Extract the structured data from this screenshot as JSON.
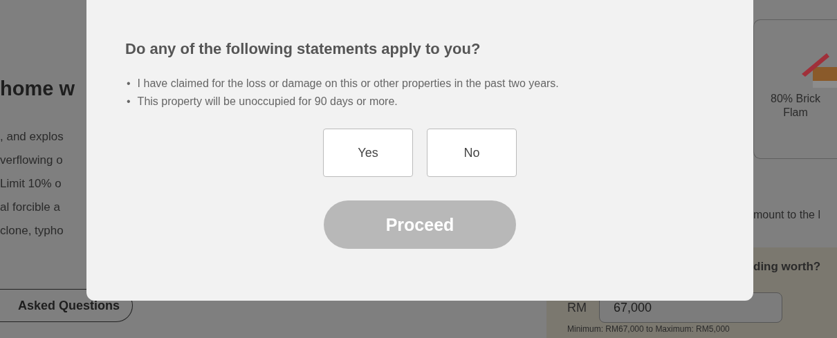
{
  "background": {
    "left_heading": "home w",
    "left_lines": [
      ", and explos",
      "verflowing o",
      " Limit 10% o",
      "al forcible a",
      "clone, typho"
    ],
    "faq_button": "Asked Questions",
    "construction_card": {
      "lines": [
        "80% Brick",
        "Flam"
      ]
    },
    "right_note": "mount to the l",
    "worth_question": "ding worth?",
    "currency": "RM",
    "amount": "67,000",
    "range_hint": "Minimum: RM67,000 to Maximum: RM5,000"
  },
  "dialog": {
    "title": "Do any of the following statements apply to you?",
    "statements": [
      {
        "bullet": "•",
        "text": "I have claimed for the loss or damage on this or other properties in the past two years."
      },
      {
        "bullet": "•",
        "text": "This property will be unoccupied for 90 days or more."
      }
    ],
    "options": [
      {
        "label": "Yes",
        "selected": false
      },
      {
        "label": "No",
        "selected": false
      }
    ],
    "proceed": {
      "label": "Proceed",
      "disabled": true
    }
  }
}
